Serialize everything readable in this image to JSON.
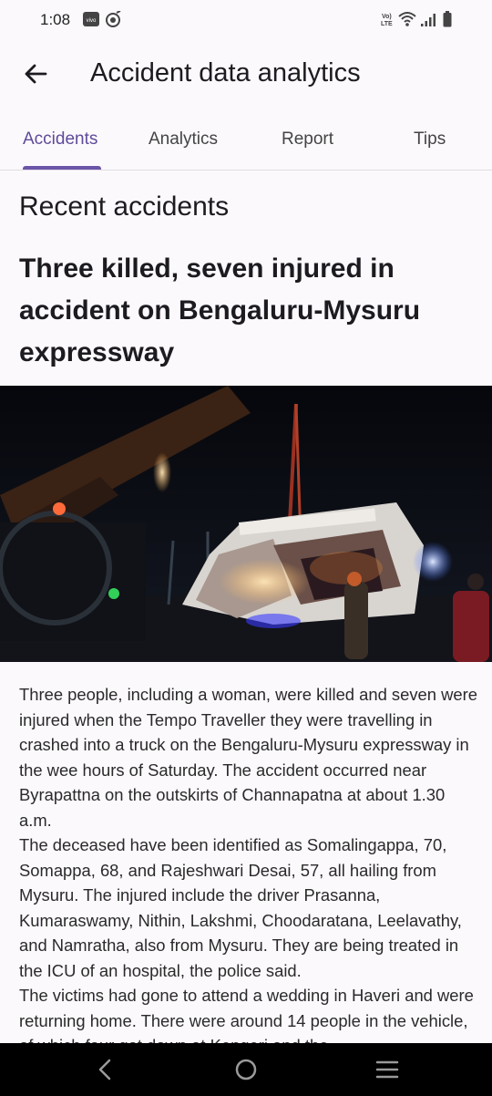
{
  "status_bar": {
    "time": "1:08",
    "icons": [
      "vivo-app-icon",
      "music-icon",
      "volte-lte-icon",
      "wifi-icon",
      "signal-icon",
      "battery-icon"
    ]
  },
  "app_bar": {
    "back_icon": "arrow-back-icon",
    "title": "Accident data analytics"
  },
  "tabs": [
    {
      "label": "Accidents",
      "active": true
    },
    {
      "label": "Analytics",
      "active": false
    },
    {
      "label": "Report",
      "active": false
    },
    {
      "label": "Tips",
      "active": false
    }
  ],
  "content": {
    "section_title": "Recent accidents",
    "headline": "Three killed, seven injured in accident on Bengaluru-Mysuru expressway",
    "image_icon": "accident-photo",
    "body": "Three people, including a woman, were killed and seven were injured when the Tempo Traveller they were travelling in crashed into a truck on the Bengaluru-Mysuru expressway in the wee hours of Saturday. The accident occurred near Byrapattna on the outskirts of Channapatna at about 1.30 a.m.\n The deceased have been identified as Somalingappa, 70, Somappa, 68, and Rajeshwari Desai, 57, all hailing from Mysuru. The injured include the driver Prasanna, Kumaraswamy, Nithin, Lakshmi, Choodaratana, Leelavathy, and Namratha, also from Mysuru. They are being treated in the ICU of an hospital, the police said.\n The victims had gone to attend a wedding in Haveri and were returning home. There were around 14 people in the vehicle, of which four got down at Kengeri and the"
  },
  "nav_bar": {
    "icons": [
      "back-nav-icon",
      "home-nav-icon",
      "menu-nav-icon"
    ]
  },
  "colors": {
    "accent": "#6b56a8",
    "background": "#fcf9fd",
    "nav_background": "#000000"
  }
}
